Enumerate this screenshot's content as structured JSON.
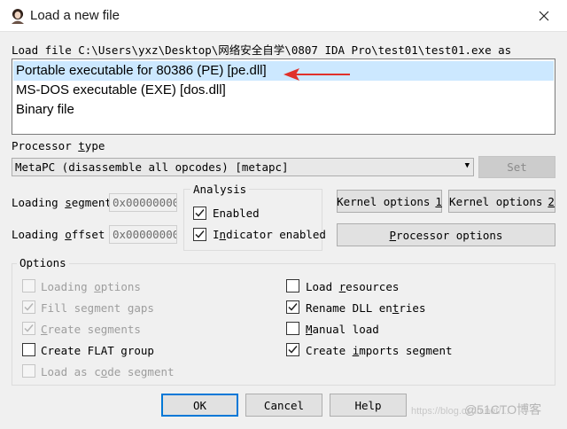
{
  "window": {
    "title": "Load a new file",
    "icon": "ida-icon"
  },
  "load_file_label": "Load file C:\\Users\\yxz\\Desktop\\网络安全自学\\0807 IDA Pro\\test01\\test01.exe as",
  "file_types": [
    "Portable executable for 80386 (PE) [pe.dll]",
    "MS-DOS executable (EXE) [dos.dll]",
    "Binary file"
  ],
  "selected_file_type": 0,
  "processor": {
    "label": "Processor type",
    "value": "MetaPC (disassemble all opcodes) [metapc]",
    "set_button": "Set"
  },
  "segments": {
    "loading_segment_label": "Loading segment",
    "loading_segment_value": "0x00000000",
    "loading_offset_label": "Loading offset",
    "loading_offset_value": "0x00000000"
  },
  "analysis": {
    "legend": "Analysis",
    "enabled_label": "Enabled",
    "enabled_checked": true,
    "indicator_label": "Indicator enabled",
    "indicator_checked": true
  },
  "buttons": {
    "kernel_options_1": "Kernel options 1",
    "kernel_options_2": "Kernel options 2",
    "processor_options": "Processor options",
    "ok": "OK",
    "cancel": "Cancel",
    "help": "Help"
  },
  "options": {
    "legend": "Options",
    "left": [
      {
        "label": "Loading options",
        "checked": false,
        "enabled": false
      },
      {
        "label": "Fill segment gaps",
        "checked": true,
        "enabled": false
      },
      {
        "label": "Create segments",
        "checked": true,
        "enabled": false
      },
      {
        "label": "Create FLAT group",
        "checked": false,
        "enabled": true
      },
      {
        "label": "Load as code segment",
        "checked": false,
        "enabled": false
      }
    ],
    "right": [
      {
        "label": "Load resources",
        "checked": false,
        "enabled": true
      },
      {
        "label": "Rename DLL entries",
        "checked": true,
        "enabled": true
      },
      {
        "label": "Manual load",
        "checked": false,
        "enabled": true
      },
      {
        "label": "Create imports segment",
        "checked": true,
        "enabled": true
      }
    ]
  },
  "watermark": {
    "text": "https://blog.csdn.net/...",
    "logo": "@51CTO博客"
  },
  "colors": {
    "selection": "#cce8ff",
    "arrow": "#e0302a",
    "default_button_border": "#0078d7"
  }
}
